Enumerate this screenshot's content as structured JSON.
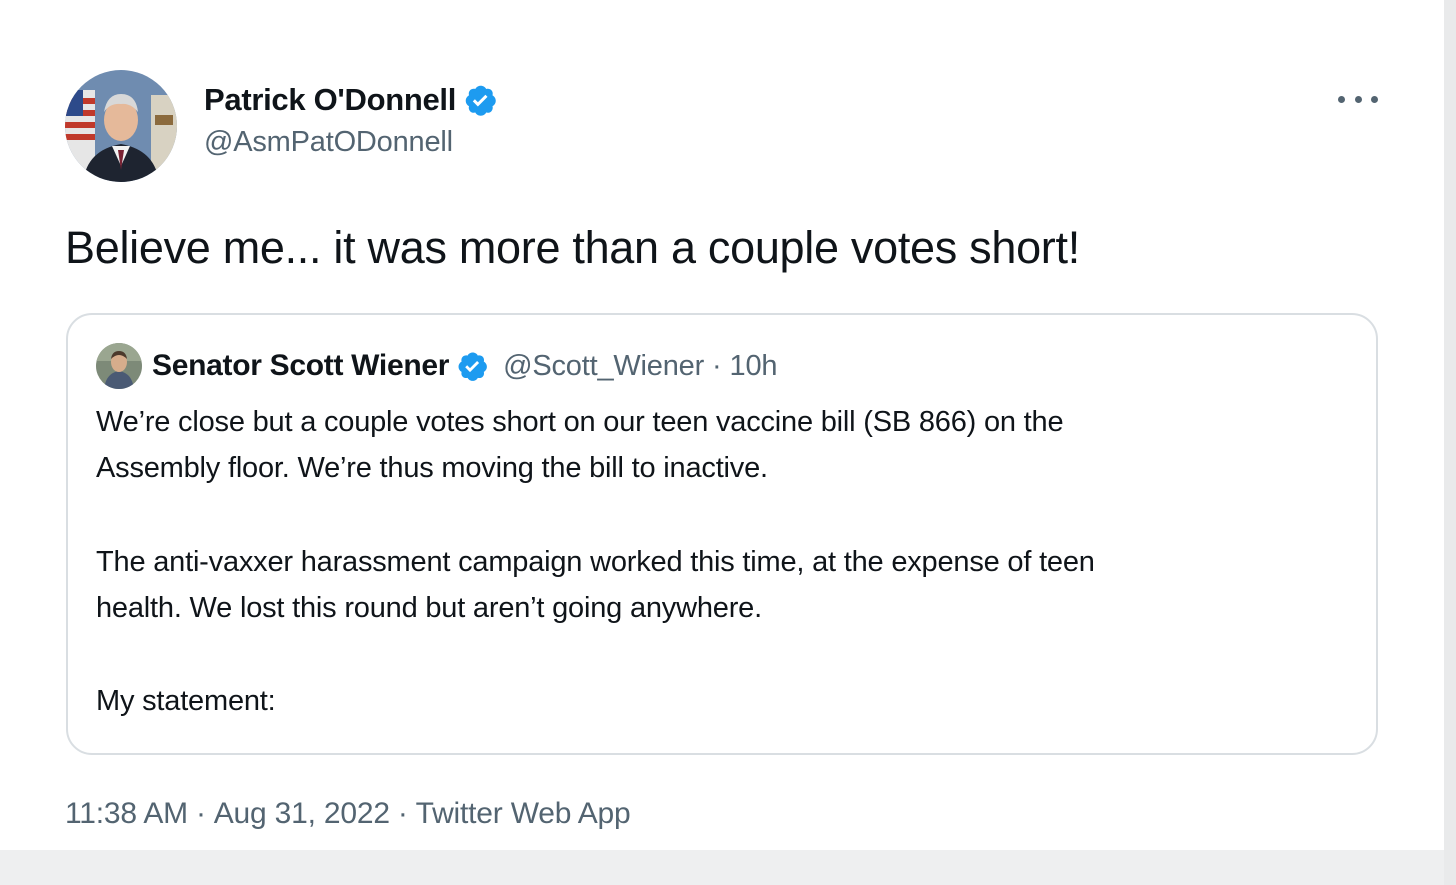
{
  "author": {
    "display_name": "Patrick O'Donnell",
    "handle": "@AsmPatODonnell",
    "verified_icon": "verified-badge-icon",
    "avatar_icon": "profile-photo"
  },
  "tweet": {
    "text": "Believe me... it was more than a couple votes short!"
  },
  "quoted": {
    "display_name": "Senator Scott Wiener",
    "handle": "@Scott_Wiener",
    "separator": "·",
    "time": "10h",
    "paragraphs": [
      [
        "We’re close but a couple votes short on our teen vaccine bill (SB 866) on the",
        "Assembly floor. We’re thus moving the bill to inactive."
      ],
      [
        "The anti-vaxxer harassment campaign worked this time, at the expense of teen",
        "health. We lost this round but aren’t going anywhere."
      ],
      [
        "My statement:"
      ]
    ]
  },
  "meta": {
    "time": "11:38 AM",
    "date": "Aug 31, 2022",
    "source": "Twitter Web App",
    "separator": "·"
  },
  "colors": {
    "verified_blue": "#1d9bf0",
    "secondary_text": "#536471",
    "primary_text": "#0f1419",
    "border": "#d9dee2"
  }
}
